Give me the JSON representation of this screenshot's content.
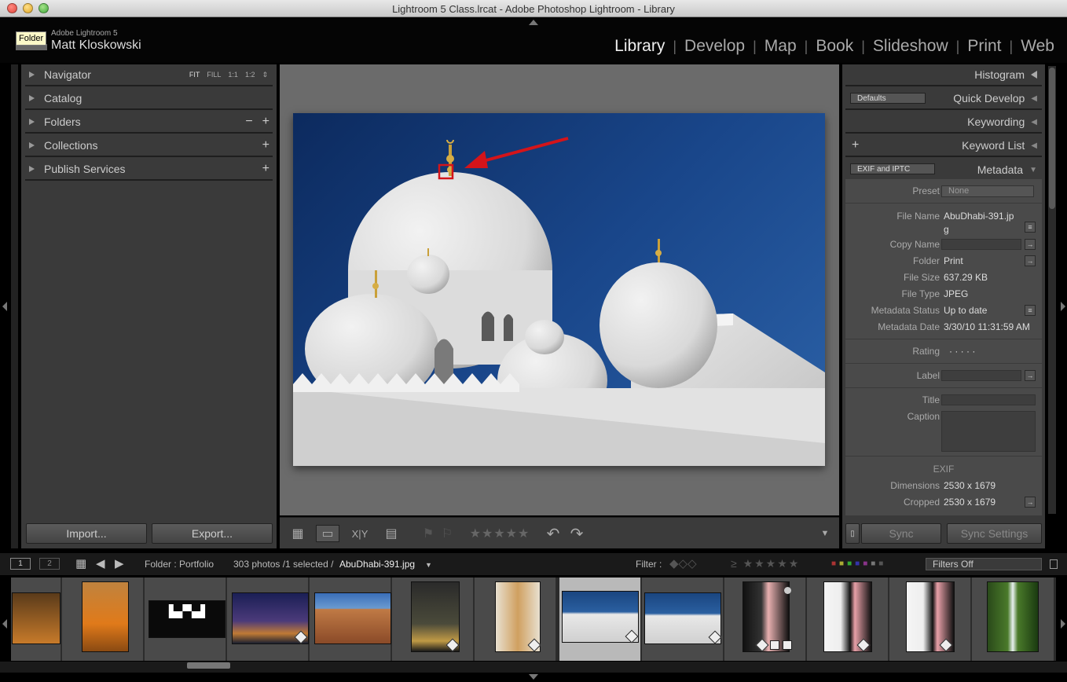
{
  "window": {
    "title": "Lightroom 5 Class.lrcat - Adobe Photoshop Lightroom - Library"
  },
  "identity": {
    "tooltip": "Folder",
    "product": "Adobe Lightroom 5",
    "user": "Matt Kloskowski"
  },
  "modules": [
    "Library",
    "Develop",
    "Map",
    "Book",
    "Slideshow",
    "Print",
    "Web"
  ],
  "left_panel": {
    "navigator": {
      "label": "Navigator",
      "zoom": [
        "FIT",
        "FILL",
        "1:1",
        "1:2"
      ]
    },
    "catalog": "Catalog",
    "folders": "Folders",
    "collections": "Collections",
    "publish": "Publish Services",
    "import_label": "Import...",
    "export_label": "Export..."
  },
  "right_panel": {
    "histogram": "Histogram",
    "quick_develop": "Quick Develop",
    "quick_develop_preset": "Defaults",
    "keywording": "Keywording",
    "keyword_list": "Keyword List",
    "metadata": "Metadata",
    "metadata_preset": "EXIF and IPTC",
    "fields": {
      "preset_key": "Preset",
      "preset_val": "None",
      "filename_key": "File Name",
      "filename_val1": "AbuDhabi-391.jp",
      "filename_val2": "g",
      "copyname_key": "Copy Name",
      "folder_key": "Folder",
      "folder_val": "Print",
      "filesize_key": "File Size",
      "filesize_val": "637.29 KB",
      "filetype_key": "File Type",
      "filetype_val": "JPEG",
      "mstatus_key": "Metadata Status",
      "mstatus_val": "Up to date",
      "mdate_key": "Metadata Date",
      "mdate_val": "3/30/10 11:31:59 AM",
      "rating_key": "Rating",
      "rating_val": "·  ·  ·  ·  ·",
      "label_key": "Label",
      "title_key": "Title",
      "caption_key": "Caption",
      "exif_header": "EXIF",
      "dimensions_key": "Dimensions",
      "dimensions_val": "2530 x 1679",
      "cropped_key": "Cropped",
      "cropped_val": "2530 x 1679"
    },
    "sync_label": "Sync",
    "sync_settings_label": "Sync Settings"
  },
  "toolbar": {
    "stars": "★★★★★"
  },
  "filmstrip_bar": {
    "monitor1": "1",
    "monitor2": "2",
    "source": "Folder : Portfolio",
    "count": "303 photos /1 selected /",
    "filename": "AbuDhabi-391.jpg",
    "filter_label": "Filter :",
    "filter_select": "Filters Off",
    "rating_filter": "≥ ★★★★★"
  },
  "colors": {
    "accent": "#eeeeee",
    "annotation_red": "#d4141a"
  }
}
